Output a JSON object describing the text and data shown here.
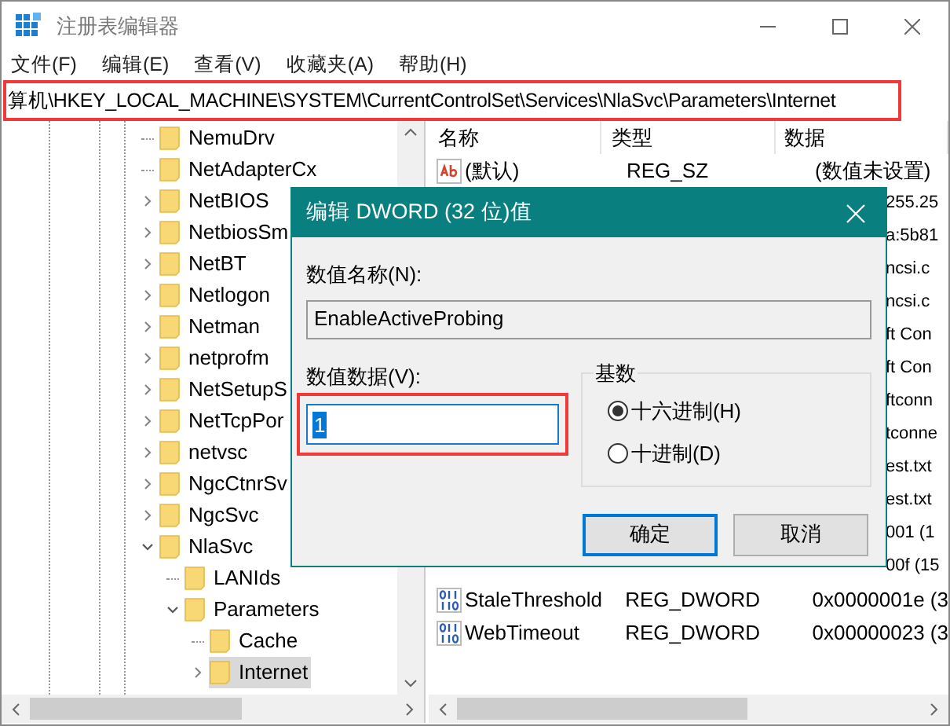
{
  "window": {
    "title": "注册表编辑器"
  },
  "menu": [
    "文件(F)",
    "编辑(E)",
    "查看(V)",
    "收藏夹(A)",
    "帮助(H)"
  ],
  "address": "算机\\HKEY_LOCAL_MACHINE\\SYSTEM\\CurrentControlSet\\Services\\NlaSvc\\Parameters\\Internet",
  "tree": [
    {
      "label": "NemuDrv",
      "kind": "leaf",
      "selected": false
    },
    {
      "label": "NetAdapterCx",
      "kind": "leaf",
      "selected": false
    },
    {
      "label": "NetBIOS",
      "kind": "branch",
      "expanded": false,
      "selected": false
    },
    {
      "label": "NetbiosSm",
      "kind": "branch",
      "expanded": false,
      "selected": false
    },
    {
      "label": "NetBT",
      "kind": "branch",
      "expanded": false,
      "selected": false
    },
    {
      "label": "Netlogon",
      "kind": "branch",
      "expanded": false,
      "selected": false
    },
    {
      "label": "Netman",
      "kind": "branch",
      "expanded": false,
      "selected": false
    },
    {
      "label": "netprofm",
      "kind": "branch",
      "expanded": false,
      "selected": false
    },
    {
      "label": "NetSetupS",
      "kind": "branch",
      "expanded": false,
      "selected": false
    },
    {
      "label": "NetTcpPor",
      "kind": "branch",
      "expanded": false,
      "selected": false
    },
    {
      "label": "netvsc",
      "kind": "branch",
      "expanded": false,
      "selected": false
    },
    {
      "label": "NgcCtnrSv",
      "kind": "branch",
      "expanded": false,
      "selected": false
    },
    {
      "label": "NgcSvc",
      "kind": "branch",
      "expanded": false,
      "selected": false
    },
    {
      "label": "NlaSvc",
      "kind": "branch",
      "expanded": true,
      "selected": false,
      "children": [
        {
          "label": "LANIds",
          "kind": "leaf",
          "selected": false
        },
        {
          "label": "Parameters",
          "kind": "branch",
          "expanded": true,
          "selected": false,
          "children": [
            {
              "label": "Cache",
              "kind": "leaf",
              "selected": false
            },
            {
              "label": "Internet",
              "kind": "branch",
              "expanded": false,
              "selected": true
            }
          ]
        }
      ]
    }
  ],
  "values": {
    "columns": [
      "名称",
      "类型",
      "数据"
    ],
    "rows": [
      {
        "kind": "string",
        "name": "(默认)",
        "type": "REG_SZ",
        "data": "(数值未设置)"
      },
      {
        "data": "255.25"
      },
      {
        "data": "a:5b81"
      },
      {
        "data": "ncsi.c"
      },
      {
        "data": "ncsi.c"
      },
      {
        "data": "ft Con"
      },
      {
        "data": "ft Con"
      },
      {
        "data": "ftconn"
      },
      {
        "data": "tconne"
      },
      {
        "data": "est.txt"
      },
      {
        "data": "est.txt"
      },
      {
        "data": "001 (1"
      },
      {
        "data": "00f (15"
      },
      {
        "kind": "dword",
        "name": "StaleThreshold",
        "type": "REG_DWORD",
        "data": "0x0000001e (3"
      },
      {
        "kind": "dword",
        "name": "WebTimeout",
        "type": "REG_DWORD",
        "data": "0x00000023 (3"
      }
    ]
  },
  "dialog": {
    "title": "编辑 DWORD (32 位)值",
    "name_label": "数值名称(N):",
    "name_value": "EnableActiveProbing",
    "data_label": "数值数据(V):",
    "data_value": "1",
    "base_label": "基数",
    "bases": [
      {
        "label": "十六进制(H)",
        "selected": true
      },
      {
        "label": "十进制(D)",
        "selected": false
      }
    ],
    "buttons": [
      {
        "label": "确定",
        "default": true
      },
      {
        "label": "取消",
        "default": false
      }
    ]
  }
}
